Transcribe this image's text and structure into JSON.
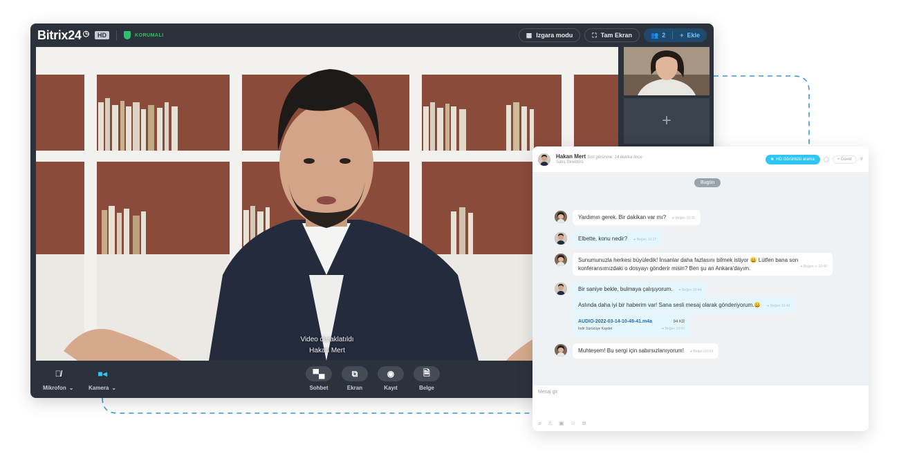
{
  "call": {
    "brand": "Bitrix24",
    "brand_icon": "clock-icon",
    "hd_badge": "HD",
    "secure_label": "KORUMALI",
    "grid_mode": "Izgara modu",
    "fullscreen": "Tam Ekran",
    "participants_count": "2",
    "add_label": "Ekle",
    "paused_text": "Video duraklatıldı",
    "speaker_name": "Hakan Mert",
    "add_tile_symbol": "+",
    "controls": {
      "mic": "Mikrofon",
      "camera": "Kamera",
      "chat": "Sohbet",
      "screen": "Ekran",
      "record": "Kayıt",
      "document": "Belge"
    }
  },
  "chat": {
    "contact_name": "Hakan Mert",
    "last_seen": "Son görünme: 14 dakika önce",
    "role": "Satış Direktörü",
    "hd_call": "HD Görüntülü arama",
    "invite": "+ Davet",
    "date": "Bugün",
    "messages": [
      {
        "text": "Yardımın gerek. Bir dakikan var mı?",
        "meta": "➔ Beğen  10:36"
      },
      {
        "text": "Elbette, konu nedir?",
        "meta": "➔ Beğen  10:37"
      },
      {
        "text_line1": "Sunumunuzla herkesi büyüledik! İnsanlar daha fazlasını bilmek istiyor 😀  Lütfen bana son",
        "text_line2": "konferansımızdaki o dosyayı gönderir misin? Ben şu an Ankara'dayım.",
        "meta": "➔ Beğen  ✔ 10:40"
      },
      {
        "text": "Bir saniye bekle, bulmaya çalışıyorum.",
        "meta": "➔ Beğen  10:44"
      },
      {
        "text": "Aslında daha iyi bir haberim var! Sana sesli mesaj olarak gönderiyorum.😀",
        "meta": "➔ Beğen  10:48"
      },
      {
        "file_name": "AUDIO-2022-03-14-10-49-41.m4a",
        "file_size": "94 KB",
        "file_links": "İndir   Sürücüye Kaydet",
        "meta": "➔ Beğen  10:50"
      },
      {
        "text": "Muhteşem!  Bu sergi için sabırsızlanıyorum!",
        "meta": "➔ Beğen  10:53"
      }
    ],
    "input_placeholder": "Mesaj gir"
  }
}
